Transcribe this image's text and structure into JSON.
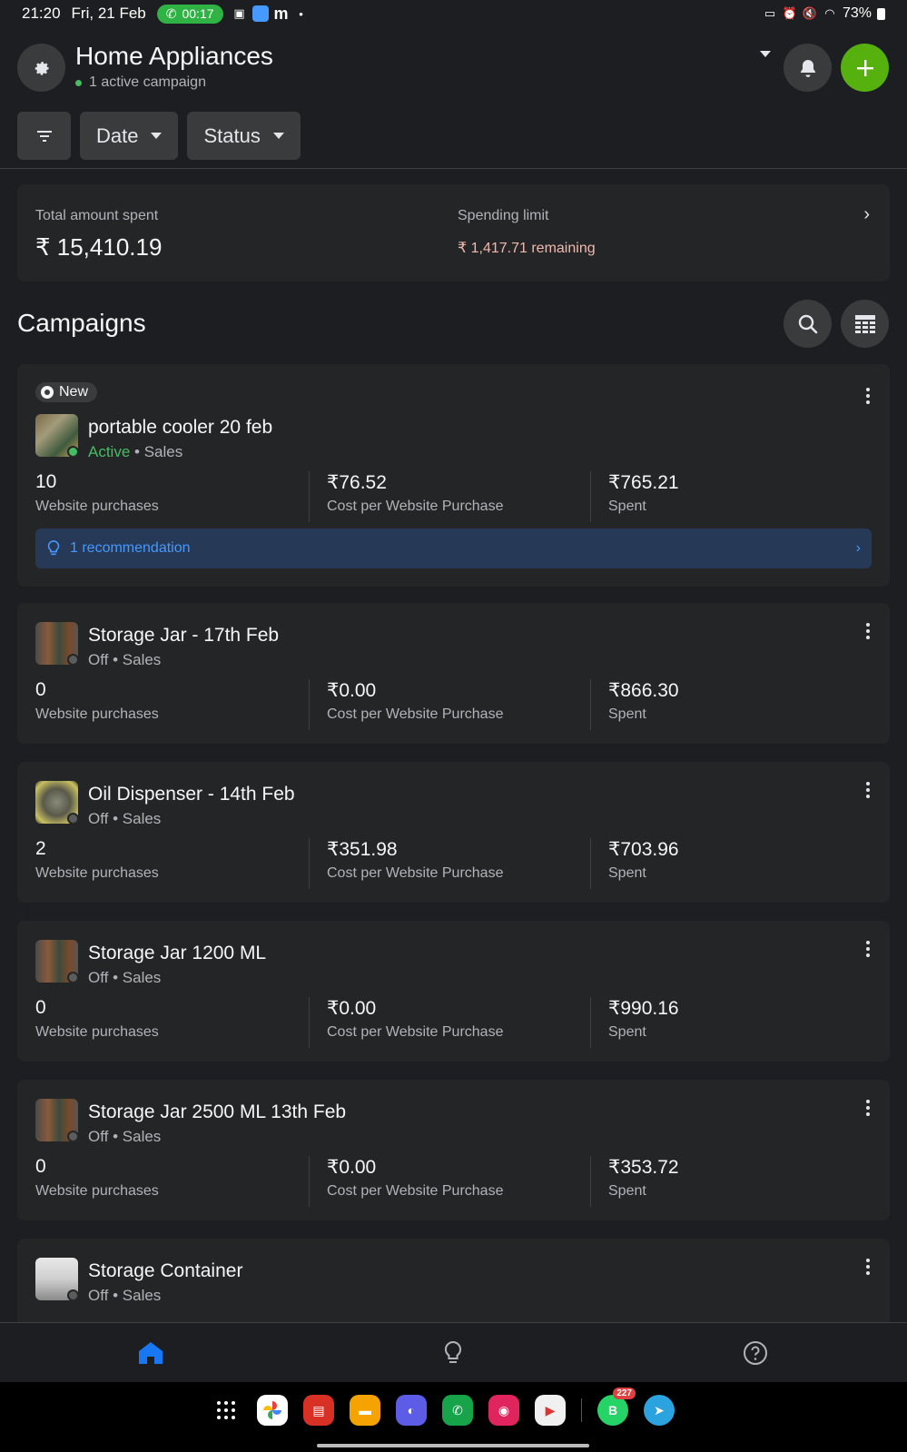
{
  "status_bar": {
    "time": "21:20",
    "date": "Fri, 21 Feb",
    "call_timer": "00:17",
    "battery": "73%"
  },
  "header": {
    "title": "Home Appliances",
    "subtitle": "1 active campaign"
  },
  "filters": {
    "date_label": "Date",
    "status_label": "Status"
  },
  "spend": {
    "total_label": "Total amount spent",
    "total_value": "₹ 15,410.19",
    "limit_label": "Spending limit",
    "limit_remaining": "₹ 1,417.71 remaining"
  },
  "campaigns_title": "Campaigns",
  "campaigns": [
    {
      "badge": "New",
      "name": "portable cooler 20 feb",
      "status": "Active",
      "objective": "Sales",
      "metrics": [
        {
          "value": "10",
          "caption": "Website purchases"
        },
        {
          "value": "₹76.52",
          "caption": "Cost per Website Purchase"
        },
        {
          "value": "₹765.21",
          "caption": "Spent"
        }
      ],
      "recommendation": "1 recommendation"
    },
    {
      "name": "Storage Jar - 17th Feb",
      "status": "Off",
      "objective": "Sales",
      "metrics": [
        {
          "value": "0",
          "caption": "Website purchases"
        },
        {
          "value": "₹0.00",
          "caption": "Cost per Website Purchase"
        },
        {
          "value": "₹866.30",
          "caption": "Spent"
        }
      ]
    },
    {
      "name": "Oil Dispenser - 14th Feb",
      "status": "Off",
      "objective": "Sales",
      "metrics": [
        {
          "value": "2",
          "caption": "Website purchases"
        },
        {
          "value": "₹351.98",
          "caption": "Cost per Website Purchase"
        },
        {
          "value": "₹703.96",
          "caption": "Spent"
        }
      ]
    },
    {
      "name": "Storage Jar 1200 ML",
      "status": "Off",
      "objective": "Sales",
      "metrics": [
        {
          "value": "0",
          "caption": "Website purchases"
        },
        {
          "value": "₹0.00",
          "caption": "Cost per Website Purchase"
        },
        {
          "value": "₹990.16",
          "caption": "Spent"
        }
      ]
    },
    {
      "name": "Storage Jar 2500 ML 13th Feb",
      "status": "Off",
      "objective": "Sales",
      "metrics": [
        {
          "value": "0",
          "caption": "Website purchases"
        },
        {
          "value": "₹0.00",
          "caption": "Cost per Website Purchase"
        },
        {
          "value": "₹353.72",
          "caption": "Spent"
        }
      ]
    },
    {
      "name": "Storage Container",
      "status": "Off",
      "objective": "Sales"
    }
  ],
  "dock": {
    "whatsapp_badge": "227"
  },
  "colors": {
    "background": "#1c1e21",
    "card": "#242526",
    "accent_green": "#56b00e",
    "active_green": "#45bd62",
    "link_blue": "#4599ff",
    "nav_active": "#1877f2"
  }
}
